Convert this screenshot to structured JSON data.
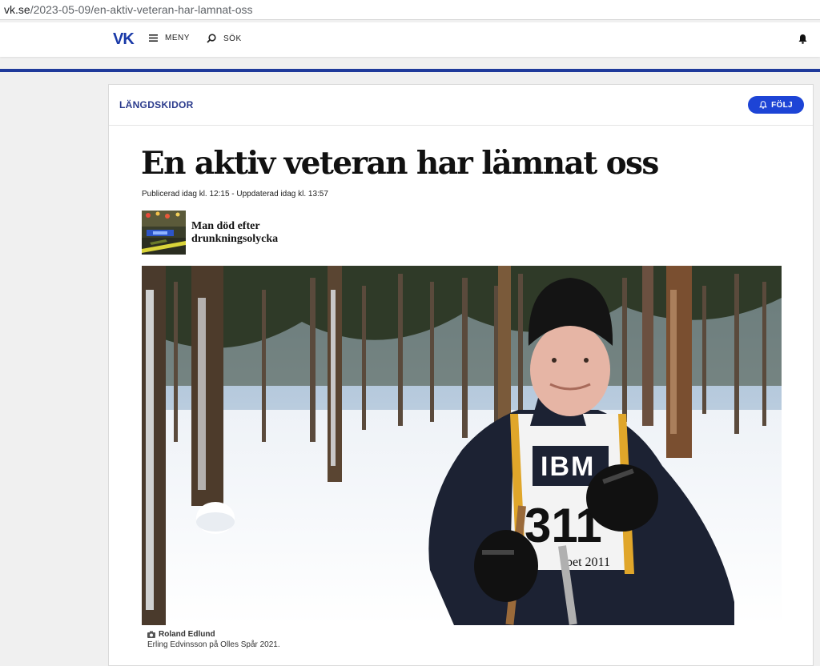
{
  "browser": {
    "url_host": "vk.se",
    "url_path": "/2023-05-09/en-aktiv-veteran-har-lamnat-oss"
  },
  "header": {
    "logo": "VK",
    "menu_label": "MENY",
    "search_label": "SÖK"
  },
  "article": {
    "category": "LÄNGDSKIDOR",
    "follow_label": "FÖLJ",
    "headline": "En aktiv veteran har lämnat oss",
    "meta": "Publicerad idag kl. 12:15 - Uppdaterad idag kl. 13:57",
    "related": {
      "title": "Man död efter drunkningsolycka"
    },
    "image": {
      "bib_sponsor": "IBM",
      "bib_number": "311",
      "bib_event": "pet 2011"
    },
    "photo_credit": "Roland Edlund",
    "caption": "Erling Edvinsson på Olles Spår 2021."
  },
  "colors": {
    "brand_blue": "#1f3a9b",
    "follow_blue": "#1d44d6",
    "category_text": "#2a3a8c"
  },
  "icons": [
    "menu-icon",
    "search-icon",
    "bell-icon",
    "camera-icon"
  ]
}
